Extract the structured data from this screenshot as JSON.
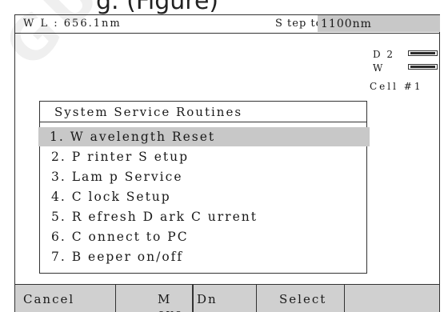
{
  "colors": {
    "screen_bg": "#ffffff",
    "highlight": "#c8c8c8",
    "softkey_bar": "#d0d0d0",
    "text": "#1a1a1a",
    "watermark": "#efefef"
  },
  "watermark_text": "GUE",
  "cut_text": "g. (Figure)",
  "status": {
    "wl": "W L : 656.1nm",
    "step_label": "S tep to",
    "step_value": "1100nm",
    "lamps": [
      {
        "label": "D 2",
        "icon": "lamp-bar-icon"
      },
      {
        "label": "W",
        "icon": "lamp-bar-icon"
      }
    ],
    "cell": "Cell #1"
  },
  "menu": {
    "title": "System Service Routines",
    "selected_index": 0,
    "items": [
      {
        "label": "1. W avelength Reset"
      },
      {
        "label": "2. P rinter S etup"
      },
      {
        "label": "3. Lam p Service"
      },
      {
        "label": "4. C lock Setup"
      },
      {
        "label": "5. R efresh D ark C urrent"
      },
      {
        "label": "6. C onnect to PC"
      },
      {
        "label": "7. B eeper on/off"
      }
    ]
  },
  "softkeys": [
    {
      "label": "Cancel"
    },
    {
      "label": "M ove"
    },
    {
      "label": "Dn"
    },
    {
      "label": "Select"
    },
    {
      "label": ""
    }
  ]
}
